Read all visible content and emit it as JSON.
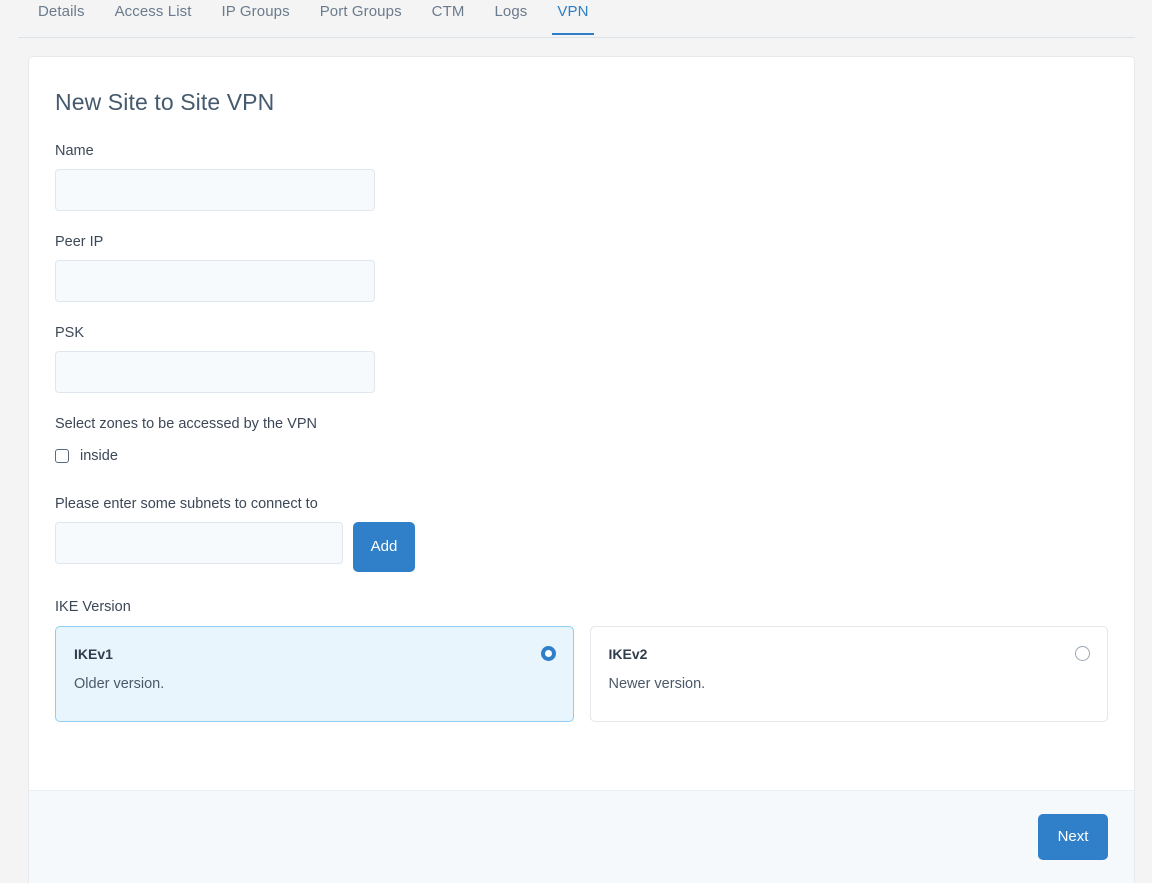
{
  "tabs": [
    {
      "label": "Details",
      "active": false
    },
    {
      "label": "Access List",
      "active": false
    },
    {
      "label": "IP Groups",
      "active": false
    },
    {
      "label": "Port Groups",
      "active": false
    },
    {
      "label": "CTM",
      "active": false
    },
    {
      "label": "Logs",
      "active": false
    },
    {
      "label": "VPN",
      "active": true
    }
  ],
  "form": {
    "title": "New Site to Site VPN",
    "name": {
      "label": "Name",
      "value": "",
      "placeholder": ""
    },
    "peer_ip": {
      "label": "Peer IP",
      "value": "",
      "placeholder": ""
    },
    "psk": {
      "label": "PSK",
      "value": "",
      "placeholder": ""
    },
    "zones": {
      "label": "Select zones to be accessed by the VPN",
      "options": [
        {
          "label": "inside",
          "checked": false
        }
      ]
    },
    "subnets": {
      "label": "Please enter some subnets to connect to",
      "value": "",
      "placeholder": "",
      "add_label": "Add"
    },
    "ike": {
      "label": "IKE Version",
      "options": [
        {
          "title": "IKEv1",
          "description": "Older version.",
          "selected": true
        },
        {
          "title": "IKEv2",
          "description": "Newer version.",
          "selected": false
        }
      ]
    }
  },
  "footer": {
    "next_label": "Next"
  },
  "colors": {
    "accent": "#3080c9",
    "tab_active": "#2c7fc4",
    "selected_card_bg": "#e8f5fd",
    "selected_card_border": "#8fcef0",
    "page_bg": "#f4f4f4",
    "footer_bg": "#f5f9fc"
  }
}
